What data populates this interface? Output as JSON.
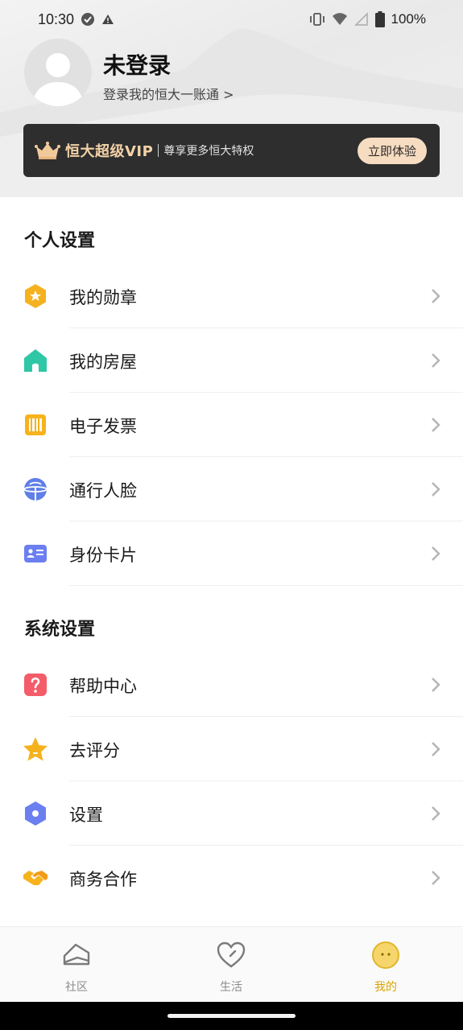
{
  "status_bar": {
    "time": "10:30",
    "battery": "100%"
  },
  "profile": {
    "name": "未登录",
    "login_link": "登录我的恒大一账通 >"
  },
  "vip": {
    "title": "恒大超级VIP",
    "subtitle": "尊享更多恒大特权",
    "button": "立即体验"
  },
  "personal": {
    "title": "个人设置",
    "items": [
      {
        "label": "我的勋章",
        "icon": "medal-icon"
      },
      {
        "label": "我的房屋",
        "icon": "house-icon"
      },
      {
        "label": "电子发票",
        "icon": "invoice-icon"
      },
      {
        "label": "通行人脸",
        "icon": "face-pass-icon"
      },
      {
        "label": "身份卡片",
        "icon": "id-card-icon"
      }
    ]
  },
  "system": {
    "title": "系统设置",
    "items": [
      {
        "label": "帮助中心",
        "icon": "help-icon"
      },
      {
        "label": "去评分",
        "icon": "star-icon"
      },
      {
        "label": "设置",
        "icon": "settings-icon"
      },
      {
        "label": "商务合作",
        "icon": "handshake-icon"
      }
    ]
  },
  "nav": {
    "items": [
      {
        "label": "社区",
        "icon": "community-icon"
      },
      {
        "label": "生活",
        "icon": "heart-icon"
      },
      {
        "label": "我的",
        "icon": "profile-face-icon",
        "active": true
      }
    ]
  },
  "colors": {
    "accent": "#d9a400",
    "vip_bg": "#2e2e2e",
    "vip_gold": "#f3d2a8"
  }
}
